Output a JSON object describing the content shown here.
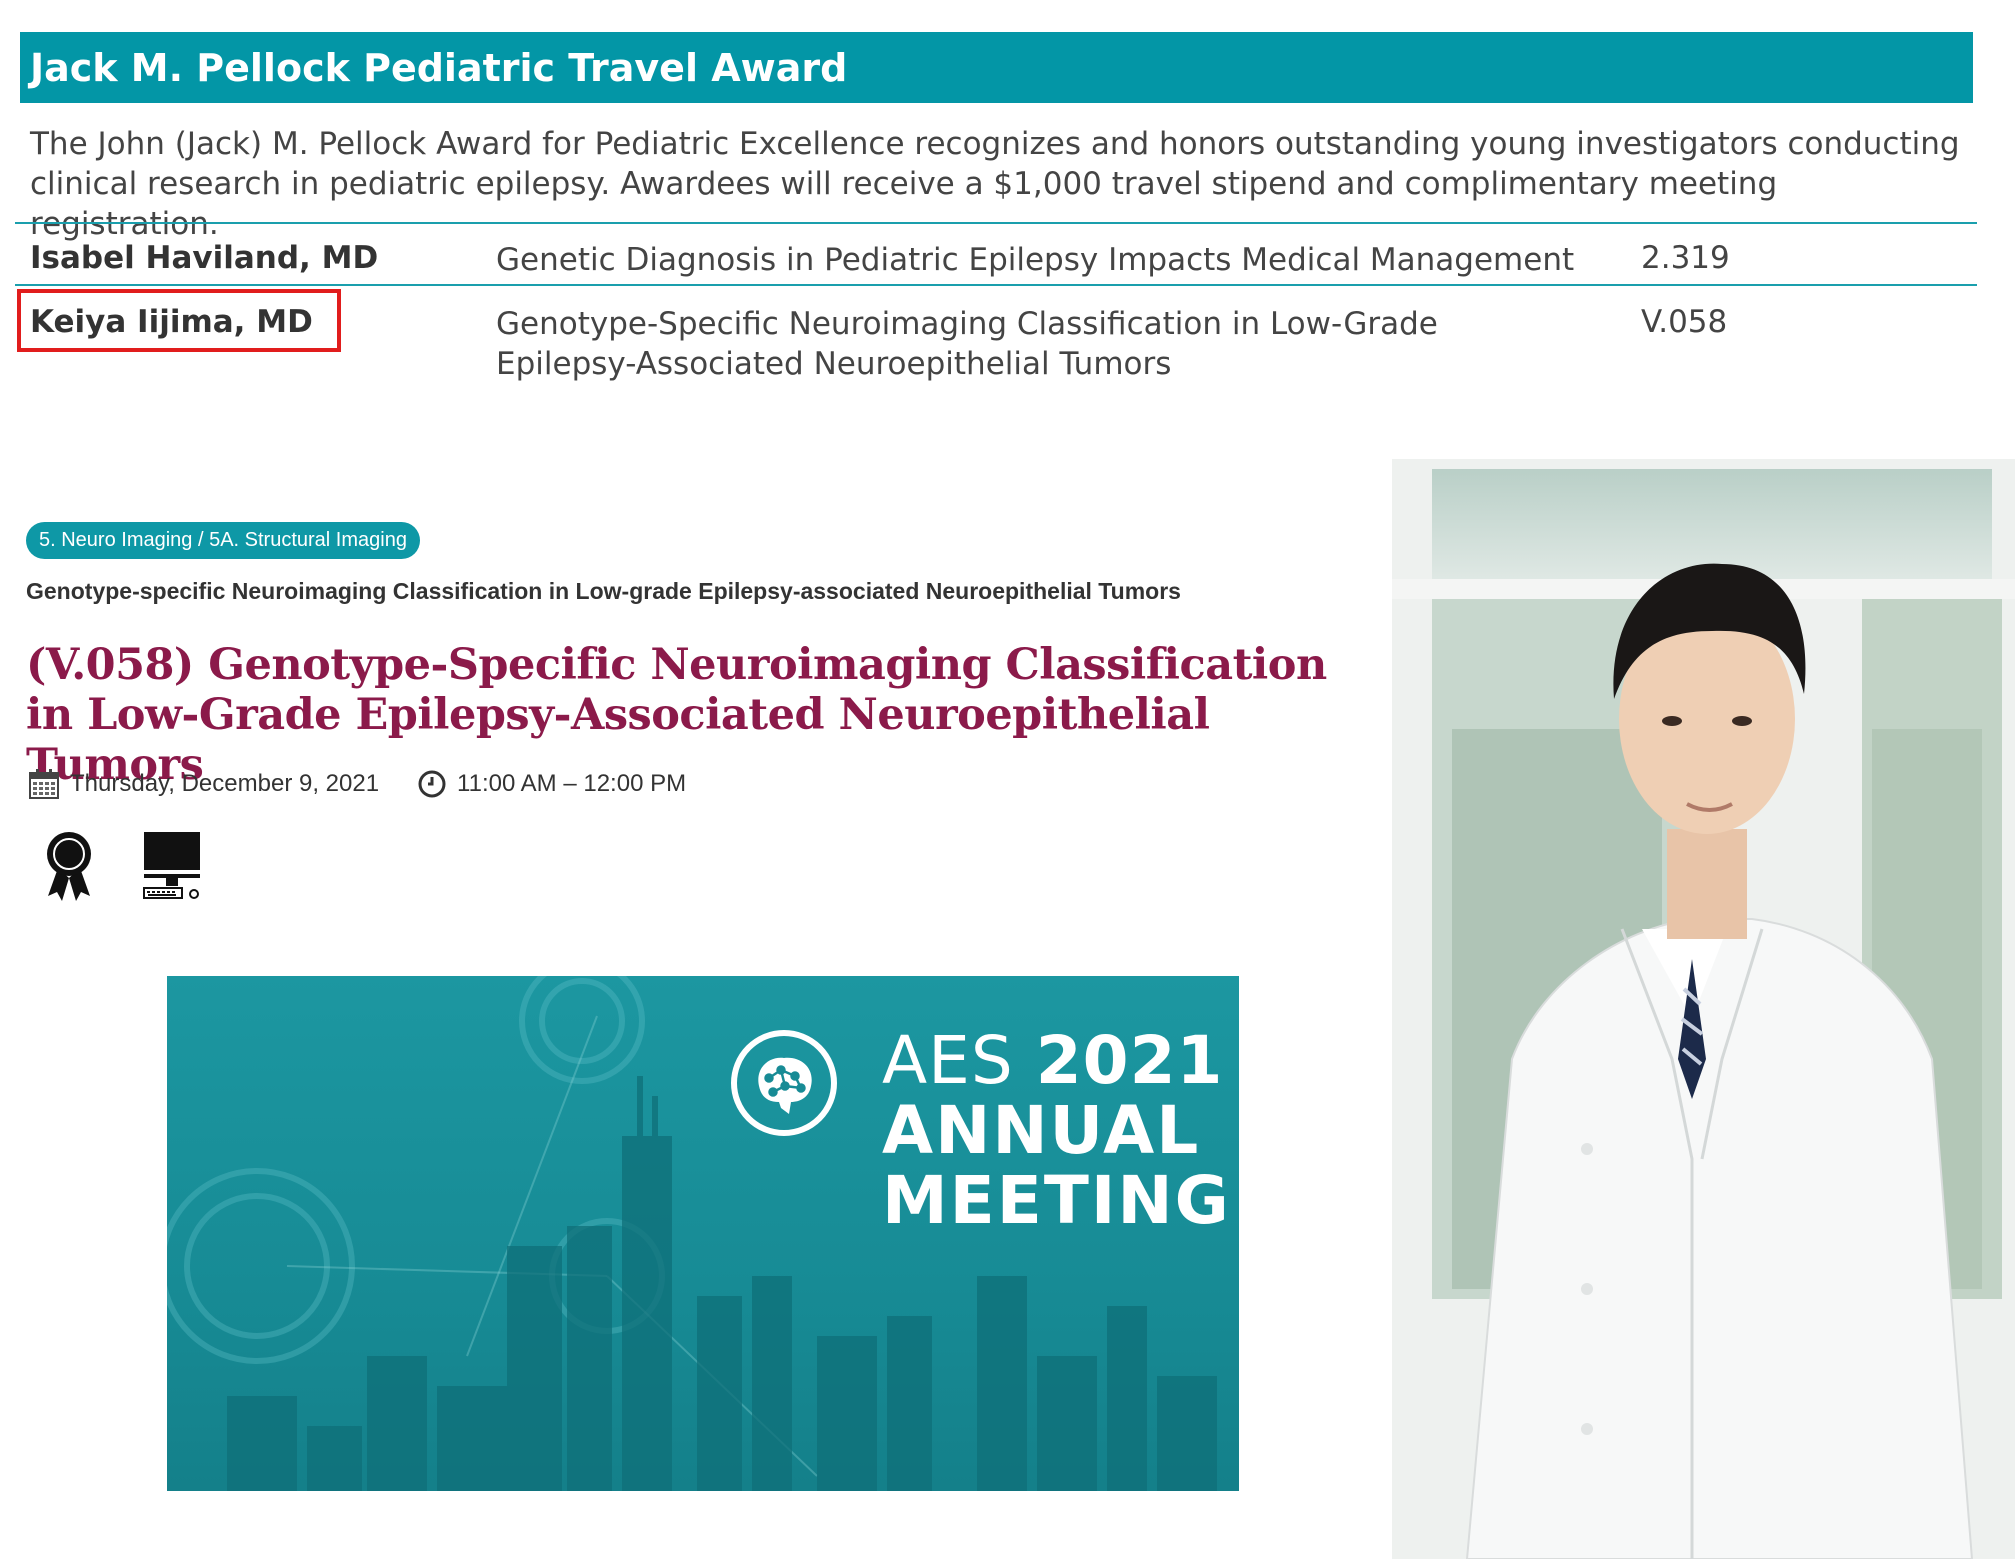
{
  "award": {
    "title": "Jack M. Pellock Pediatric Travel Award",
    "description": "The John (Jack) M. Pellock Award for Pediatric Excellence recognizes and honors outstanding young investigators conducting clinical research in pediatric epilepsy. Awardees will receive a $1,000 travel stipend and complimentary meeting registration.",
    "awardees": [
      {
        "name": "Isabel Haviland, MD",
        "title": "Genetic Diagnosis in Pediatric Epilepsy Impacts Medical Management",
        "code": "2.319"
      },
      {
        "name": "Keiya Iijima, MD",
        "title": "Genotype-Specific Neuroimaging Classification in Low-Grade Epilepsy-Associated Neuroepithelial Tumors",
        "code": "V.058"
      }
    ]
  },
  "session": {
    "track": "5. Neuro Imaging / 5A. Structural Imaging",
    "subtitle": "Genotype-specific Neuroimaging Classification in Low-grade Epilepsy-associated Neuroepithelial Tumors",
    "title": "(V.058) Genotype-Specific Neuroimaging Classification in Low-Grade Epilepsy-Associated Neuroepithelial Tumors",
    "date": "Thursday, December 9, 2021",
    "time": "11:00 AM – 12:00 PM",
    "icons": [
      "calendar-icon",
      "clock-icon",
      "award-ribbon-icon",
      "computer-icon"
    ]
  },
  "banner": {
    "line1_prefix": "AES",
    "line1_year": "2021",
    "line2": "ANNUAL",
    "line3": "MEETING"
  },
  "colors": {
    "header_teal": "#0396a6",
    "title_maroon": "#8b1a4a",
    "highlight_red": "#e11d1d",
    "banner_teal": "#178b95"
  }
}
